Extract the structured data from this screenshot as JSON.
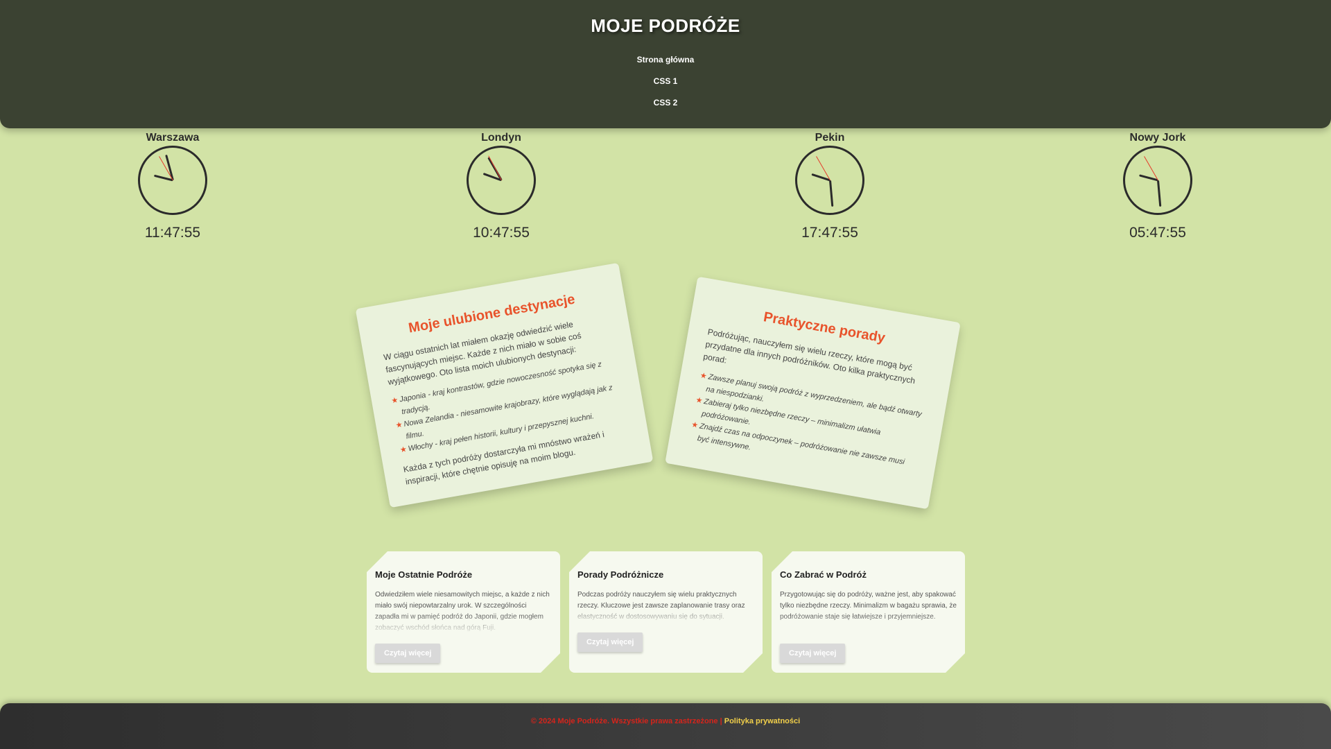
{
  "header": {
    "title": "MOJE PODRÓŻE",
    "nav": [
      "Strona główna",
      "CSS 1",
      "CSS 2"
    ]
  },
  "clocks": [
    {
      "city": "Warszawa",
      "time": "11:47:55"
    },
    {
      "city": "Londyn",
      "time": "10:47:55"
    },
    {
      "city": "Pekin",
      "time": "17:47:55"
    },
    {
      "city": "Nowy Jork",
      "time": "05:47:55"
    }
  ],
  "destinations": {
    "title": "Moje ulubione destynacje",
    "intro": "W ciągu ostatnich lat miałem okazję odwiedzić wiele fascynujących miejsc. Każde z nich miało w sobie coś wyjątkowego. Oto lista moich ulubionych destynacji:",
    "items": [
      "Japonia - kraj kontrastów, gdzie nowoczesność spotyka się z tradycją.",
      "Nowa Zelandia - niesamowite krajobrazy, które wyglądają jak z filmu.",
      "Włochy - kraj pełen historii, kultury i przepysznej kuchni."
    ],
    "outro": "Każda z tych podróży dostarczyła mi mnóstwo wrażeń i inspiracji, które chętnie opisuję na moim blogu."
  },
  "tips": {
    "title": "Praktyczne porady",
    "intro": "Podróżując, nauczyłem się wielu rzeczy, które mogą być przydatne dla innych podróżników. Oto kilka praktycznych porad:",
    "items": [
      "Zawsze planuj swoją podróż z wyprzedzeniem, ale bądź otwarty na niespodzianki.",
      "Zabieraj tylko niezbędne rzeczy – minimalizm ułatwia podróżowanie.",
      "Znajdź czas na odpoczynek – podróżowanie nie zawsze musi być intensywne."
    ]
  },
  "blog": [
    {
      "title": "Moje Ostatnie Podróże",
      "text": "Odwiedziłem wiele niesamowitych miejsc, a każde z nich miało swój niepowtarzalny urok. W szczególności zapadła mi w pamięć podróż do Japonii, gdzie mogłem zobaczyć wschód słońca nad górą Fuji.",
      "button": "Czytaj więcej"
    },
    {
      "title": "Porady Podróżnicze",
      "text": "Podczas podróży nauczyłem się wielu praktycznych rzeczy. Kluczowe jest zawsze zaplanowanie trasy oraz elastyczność w dostosowywaniu się do sytuacji.",
      "button": "Czytaj więcej"
    },
    {
      "title": "Co Zabrać w Podróż",
      "text": "Przygotowując się do podróży, ważne jest, aby spakować tylko niezbędne rzeczy. Minimalizm w bagażu sprawia, że podróżowanie staje się łatwiejsze i przyjemniejsze.",
      "button": "Czytaj więcej"
    }
  ],
  "footer": {
    "copyright": "© 2024 Moje Podróże. Wszystkie prawa zastrzeżone |",
    "privacy": "Polityka prywatności"
  },
  "colors": {
    "background": "#d2e3a6",
    "header": "#3b4232",
    "accent": "#e8532b",
    "card": "#eaf2dc"
  }
}
